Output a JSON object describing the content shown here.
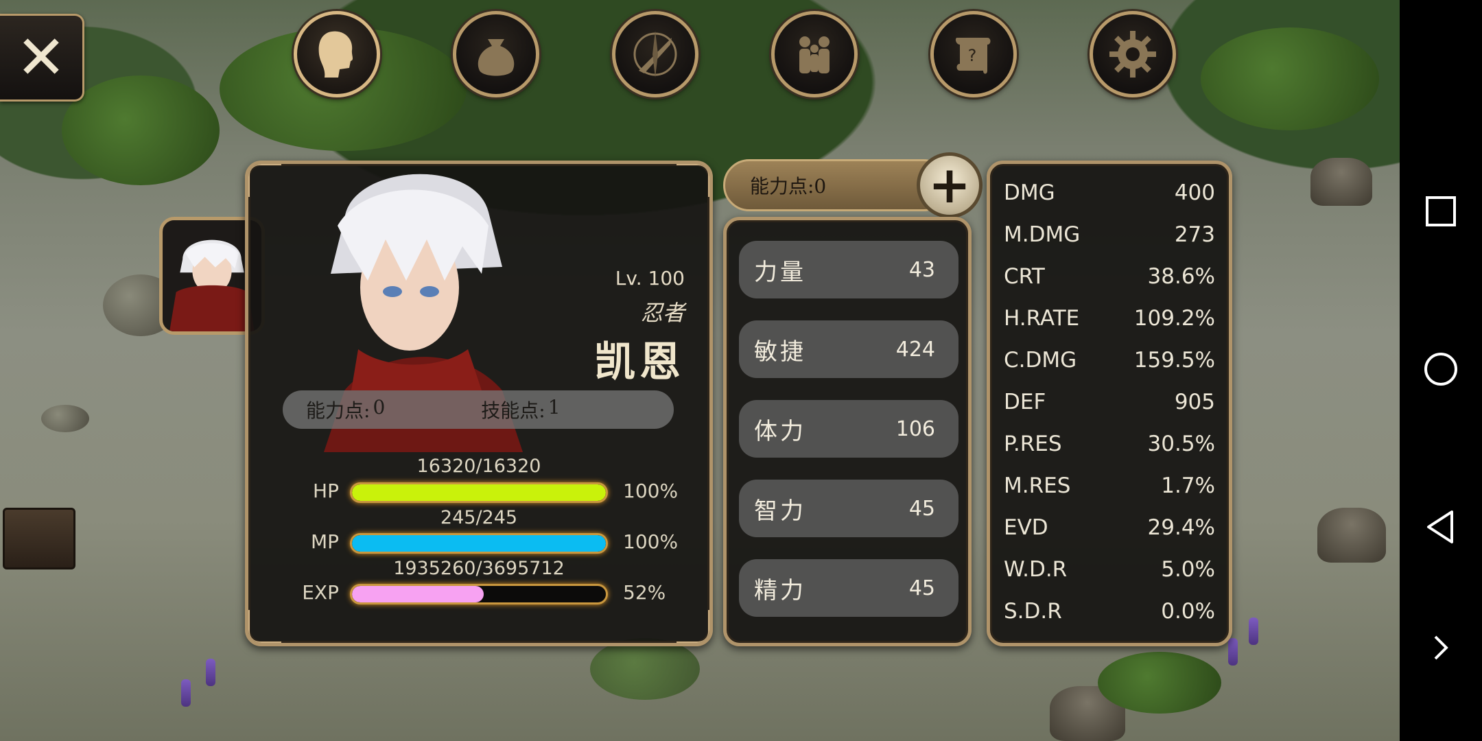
{
  "tabs": [
    {
      "name": "character",
      "icon": "head-icon",
      "active": true
    },
    {
      "name": "inventory",
      "icon": "bag-icon",
      "active": false
    },
    {
      "name": "skills",
      "icon": "compass-sword-icon",
      "active": false
    },
    {
      "name": "party",
      "icon": "people-icon",
      "active": false
    },
    {
      "name": "quests",
      "icon": "scroll-icon",
      "active": false
    },
    {
      "name": "settings",
      "icon": "gear-icon",
      "active": false
    }
  ],
  "character": {
    "level": "Lv. 100",
    "job": "忍者",
    "name": "凯恩",
    "ability_points": {
      "label": "能力点:",
      "value": "0"
    },
    "skill_points": {
      "label": "技能点:",
      "value": "1"
    },
    "hp": {
      "label": "HP",
      "value": "16320/16320",
      "percent": "100%",
      "fraction": 1.0,
      "color": "#c9f20b"
    },
    "mp": {
      "label": "MP",
      "value": "245/245",
      "percent": "100%",
      "fraction": 1.0,
      "color": "#0bbcf2"
    },
    "exp": {
      "label": "EXP",
      "value": "1935260/3695712",
      "percent": "52%",
      "fraction": 0.52,
      "color": "#f7a2f2"
    }
  },
  "ability_header": "能力点:0",
  "attributes": [
    {
      "name": "力量",
      "value": "43"
    },
    {
      "name": "敏捷",
      "value": "424"
    },
    {
      "name": "体力",
      "value": "106"
    },
    {
      "name": "智力",
      "value": "45"
    },
    {
      "name": "精力",
      "value": "45"
    }
  ],
  "combat_stats": [
    {
      "name": "DMG",
      "value": "400"
    },
    {
      "name": "M.DMG",
      "value": "273"
    },
    {
      "name": "CRT",
      "value": "38.6%"
    },
    {
      "name": "H.RATE",
      "value": "109.2%"
    },
    {
      "name": "C.DMG",
      "value": "159.5%"
    },
    {
      "name": "DEF",
      "value": "905"
    },
    {
      "name": "P.RES",
      "value": "30.5%"
    },
    {
      "name": "M.RES",
      "value": "1.7%"
    },
    {
      "name": "EVD",
      "value": "29.4%"
    },
    {
      "name": "W.D.R",
      "value": "5.0%"
    },
    {
      "name": "S.D.R",
      "value": "0.0%"
    }
  ]
}
